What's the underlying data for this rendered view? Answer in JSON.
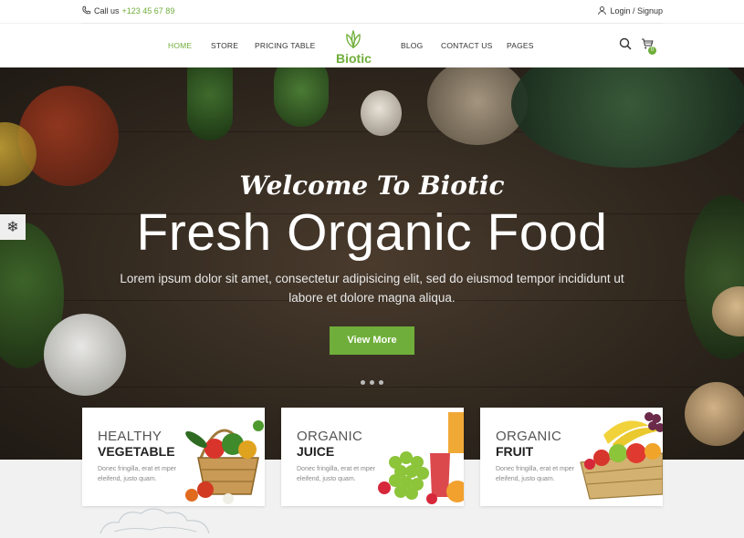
{
  "topbar": {
    "call_label": "Call us",
    "phone": "+123 45 67 89",
    "login": "Login / Signup"
  },
  "nav": {
    "items": [
      "HOME",
      "STORE",
      "PRICING TABLE",
      "BLOG",
      "CONTACT US",
      "PAGES"
    ],
    "logo": "Biotic",
    "cart_count": "0"
  },
  "hero": {
    "script": "Welcome To Biotic",
    "title": "Fresh Organic Food",
    "description": "Lorem ipsum dolor sit amet, consectetur adipisicing elit, sed do eiusmod tempor incididunt ut labore et dolore magna aliqua.",
    "button": "View More"
  },
  "cards": [
    {
      "line1": "HEALTHY",
      "line2": "VEGETABLE",
      "text": "Donec fringilla, erat et mper eleifend, justo quam."
    },
    {
      "line1": "ORGANIC",
      "line2": "JUICE",
      "text": "Donec fringilla, erat et mper eleifend, justo quam."
    },
    {
      "line1": "ORGANIC",
      "line2": "FRUIT",
      "text": "Donec fringilla, erat et mper eleifend, justo quam."
    }
  ],
  "colors": {
    "accent": "#6fae3a"
  },
  "icons": [
    "phone-icon",
    "user-icon",
    "leaf-logo-icon",
    "search-icon",
    "cart-icon",
    "gear-icon"
  ]
}
